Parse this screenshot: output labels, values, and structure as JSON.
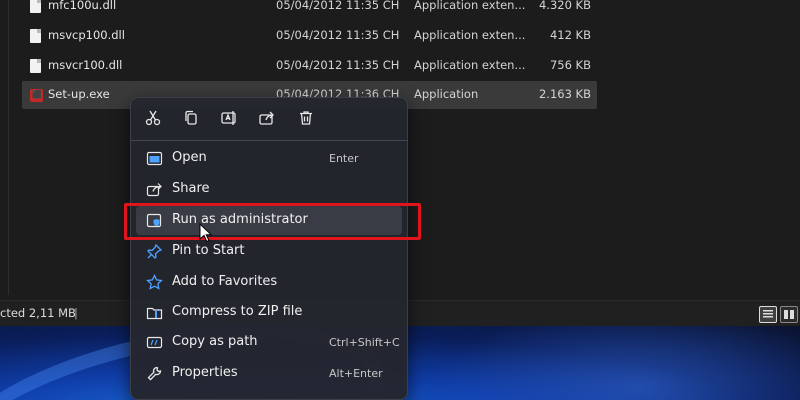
{
  "files": [
    {
      "name": "mfc100u.dll",
      "date": "05/04/2012 11:35 CH",
      "type": "Application exten...",
      "size": "4.320 KB",
      "icon": "dll-file-icon"
    },
    {
      "name": "msvcp100.dll",
      "date": "05/04/2012 11:35 CH",
      "type": "Application exten...",
      "size": "412 KB",
      "icon": "dll-file-icon"
    },
    {
      "name": "msvcr100.dll",
      "date": "05/04/2012 11:35 CH",
      "type": "Application exten...",
      "size": "756 KB",
      "icon": "dll-file-icon"
    },
    {
      "name": "Set-up.exe",
      "date": "05/04/2012 11:36 CH",
      "type": "Application",
      "size": "2.163 KB",
      "icon": "exe-file-icon"
    }
  ],
  "status_bar": {
    "selected_text": "cted  2,11 MB",
    "separator": "|"
  },
  "quick_actions": [
    {
      "name": "cut",
      "icon": "scissors-icon"
    },
    {
      "name": "copy",
      "icon": "copy-icon"
    },
    {
      "name": "rename",
      "icon": "rename-icon"
    },
    {
      "name": "share",
      "icon": "share-icon"
    },
    {
      "name": "delete",
      "icon": "trash-icon"
    }
  ],
  "menu": {
    "open": {
      "label": "Open",
      "shortcut": "Enter",
      "icon": "open-window-icon"
    },
    "share": {
      "label": "Share",
      "shortcut": "",
      "icon": "share-icon"
    },
    "run_admin": {
      "label": "Run as administrator",
      "shortcut": "",
      "icon": "shield-icon"
    },
    "pin_start": {
      "label": "Pin to Start",
      "shortcut": "",
      "icon": "pin-icon"
    },
    "favorites": {
      "label": "Add to Favorites",
      "shortcut": "",
      "icon": "star-icon"
    },
    "compress": {
      "label": "Compress to ZIP file",
      "shortcut": "",
      "icon": "zip-folder-icon"
    },
    "copy_path": {
      "label": "Copy as path",
      "shortcut": "Ctrl+Shift+C",
      "icon": "path-icon"
    },
    "properties": {
      "label": "Properties",
      "shortcut": "Alt+Enter",
      "icon": "wrench-icon"
    }
  },
  "colors": {
    "highlight_box": "#e0141c",
    "accent_icon": "#4da3ff"
  }
}
